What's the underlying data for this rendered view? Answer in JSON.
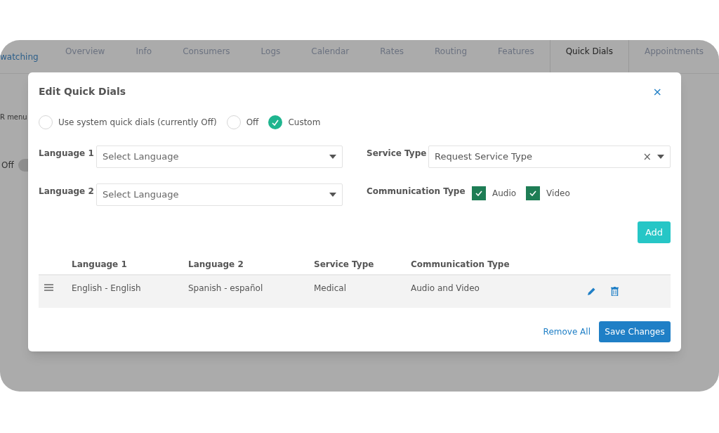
{
  "background_app": {
    "header_link": "watching",
    "tabs": [
      {
        "label": "Overview",
        "selected": false
      },
      {
        "label": "Info",
        "selected": false
      },
      {
        "label": "Consumers",
        "selected": false
      },
      {
        "label": "Logs",
        "selected": false
      },
      {
        "label": "Calendar",
        "selected": false
      },
      {
        "label": "Rates",
        "selected": false
      },
      {
        "label": "Routing",
        "selected": false
      },
      {
        "label": "Features",
        "selected": false
      },
      {
        "label": "Quick Dials",
        "selected": true
      },
      {
        "label": "Appointments",
        "selected": false
      }
    ],
    "menu_text": "R menu",
    "toggle": {
      "label": "Off",
      "on": false
    }
  },
  "dialog": {
    "title": "Edit Quick Dials",
    "close": "×",
    "mode_options": [
      {
        "label": "Use system quick dials (currently Off)",
        "selected": false
      },
      {
        "label": "Off",
        "selected": false
      },
      {
        "label": "Custom",
        "selected": true
      }
    ],
    "language_1": {
      "label": "Language 1",
      "placeholder": "Select Language"
    },
    "language_2": {
      "label": "Language 2",
      "placeholder": "Select Language"
    },
    "service_type": {
      "label": "Service Type",
      "value": "Request Service Type",
      "clear": "×"
    },
    "communication_type": {
      "label": "Communication Type",
      "options": [
        {
          "label": "Audio",
          "checked": true
        },
        {
          "label": "Video",
          "checked": true
        }
      ]
    },
    "add_button": "Add",
    "table": {
      "columns": [
        "Language 1",
        "Language 2",
        "Service Type",
        "Communication Type"
      ],
      "rows": [
        {
          "cells": [
            "English - English",
            "Spanish - español",
            "Medical",
            "Audio and Video"
          ]
        }
      ]
    },
    "remove_all": "Remove All",
    "save_button": "Save Changes"
  }
}
